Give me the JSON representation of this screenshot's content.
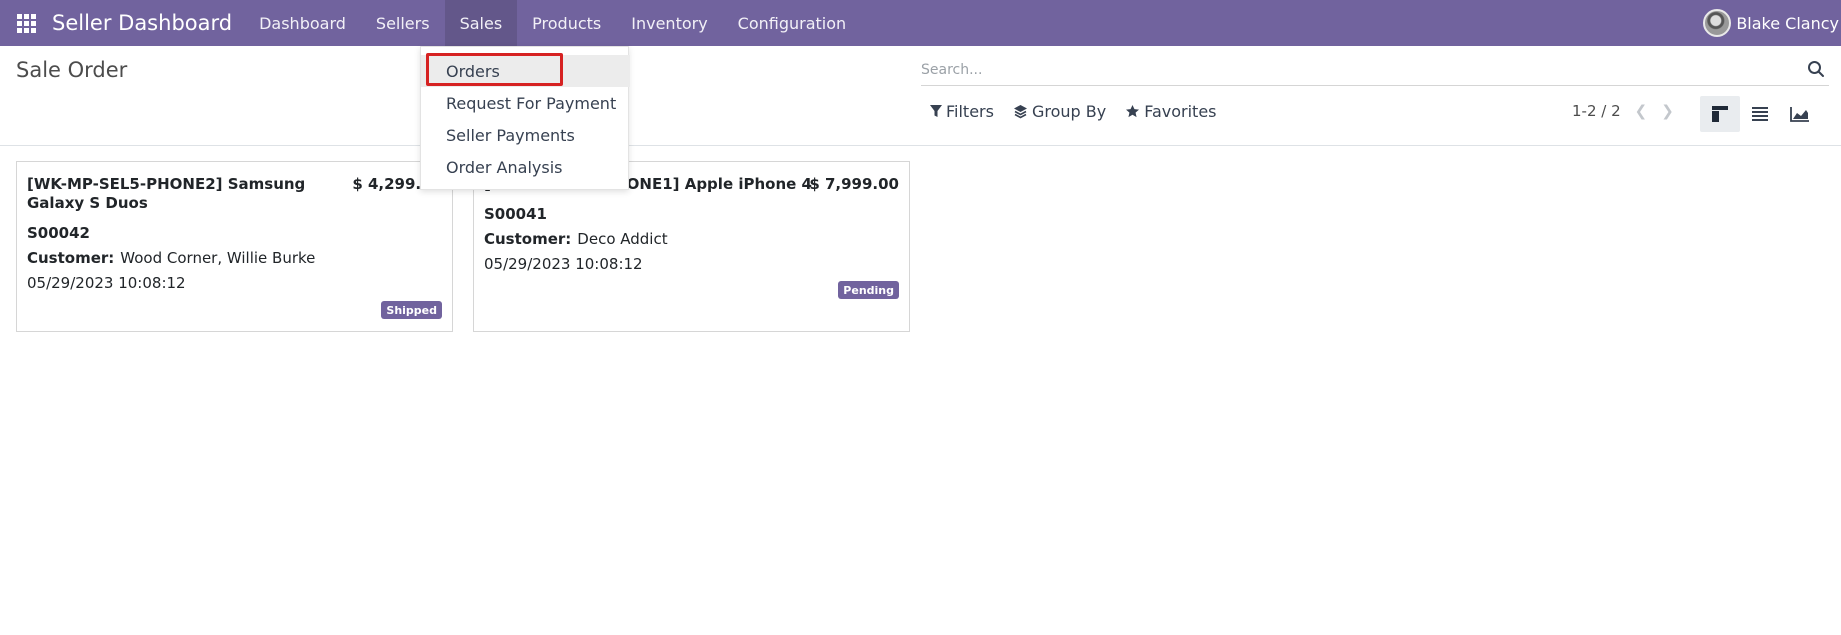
{
  "navbar": {
    "brand": "Seller Dashboard",
    "menu": [
      "Dashboard",
      "Sellers",
      "Sales",
      "Products",
      "Inventory",
      "Configuration"
    ],
    "user_name": "Blake Clancy"
  },
  "sales_menu": {
    "items": [
      "Orders",
      "Request For Payment",
      "Seller Payments",
      "Order Analysis"
    ]
  },
  "control_panel": {
    "title": "Sale Order",
    "search_placeholder": "Search...",
    "filters_label": "Filters",
    "group_by_label": "Group By",
    "favorites_label": "Favorites",
    "pager": "1-2 / 2"
  },
  "orders": [
    {
      "title": "[WK-MP-SEL5-PHONE2] Samsung Galaxy S Duos",
      "price": "$ 4,299.00",
      "ref": "S00042",
      "customer_label": "Customer:",
      "customer": "Wood Corner, Willie Burke",
      "date": "05/29/2023 10:08:12",
      "status": "Shipped"
    },
    {
      "title": "[WK-MP-SEL5-PHONE1] Apple iPhone 4",
      "price": "$ 7,999.00",
      "ref": "S00041",
      "customer_label": "Customer:",
      "customer": "Deco Addict",
      "date": "05/29/2023 10:08:12",
      "status": "Pending"
    }
  ],
  "colors": {
    "navbar": "#71639e",
    "badge": "#71639e",
    "highlight_border": "#d62222"
  }
}
